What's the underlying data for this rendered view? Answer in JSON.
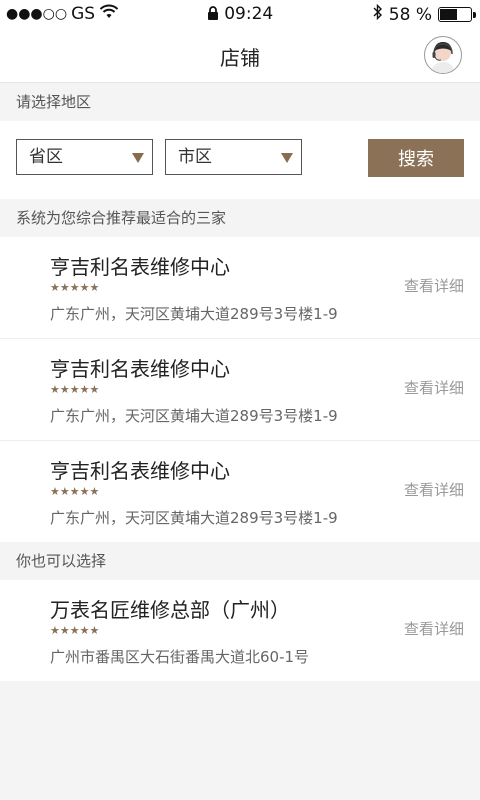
{
  "statusbar": {
    "signal": "●●●○○",
    "carrier": "GS",
    "time": "09:24",
    "battery_text": "58 %",
    "battery_level": 0.58
  },
  "navbar": {
    "title": "店铺"
  },
  "region": {
    "label": "请选择地区",
    "province_placeholder": "省区",
    "city_placeholder": "市区",
    "search_label": "搜索"
  },
  "recommended": {
    "label": "系统为您综合推荐最适合的三家",
    "stores": [
      {
        "name": "亨吉利名表维修中心",
        "rating": 5,
        "stars": "★★★★★",
        "address": "广东广州，天河区黄埔大道289号3号楼1-9",
        "detail": "查看详细"
      },
      {
        "name": "亨吉利名表维修中心",
        "rating": 5,
        "stars": "★★★★★",
        "address": "广东广州，天河区黄埔大道289号3号楼1-9",
        "detail": "查看详细"
      },
      {
        "name": "亨吉利名表维修中心",
        "rating": 5,
        "stars": "★★★★★",
        "address": "广东广州，天河区黄埔大道289号3号楼1-9",
        "detail": "查看详细"
      }
    ]
  },
  "alternative": {
    "label": "你也可以选择",
    "stores": [
      {
        "name": "万表名匠维修总部（广州）",
        "rating": 5,
        "stars": "★★★★★",
        "address": "广州市番禺区大石街番禺大道北60-1号",
        "detail": "查看详细"
      }
    ]
  },
  "colors": {
    "accent": "#8b7156",
    "background": "#f4f4f4"
  }
}
